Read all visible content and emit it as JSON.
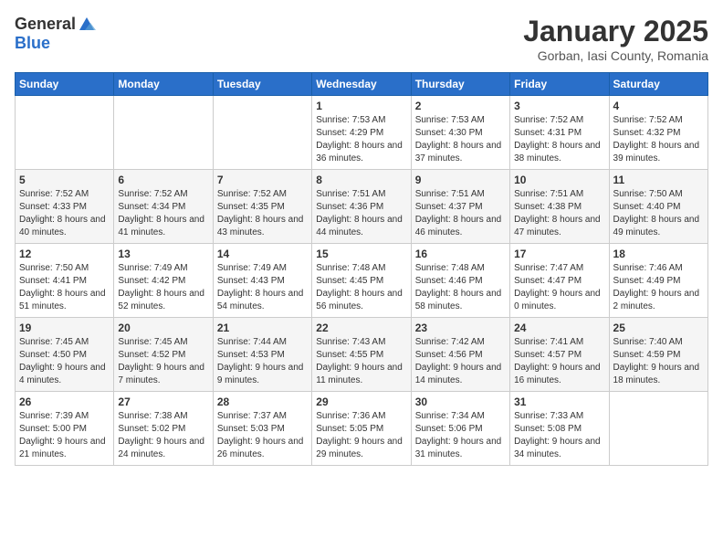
{
  "header": {
    "logo_general": "General",
    "logo_blue": "Blue",
    "month_title": "January 2025",
    "location": "Gorban, Iasi County, Romania"
  },
  "days_of_week": [
    "Sunday",
    "Monday",
    "Tuesday",
    "Wednesday",
    "Thursday",
    "Friday",
    "Saturday"
  ],
  "weeks": [
    [
      {
        "day": "",
        "info": ""
      },
      {
        "day": "",
        "info": ""
      },
      {
        "day": "",
        "info": ""
      },
      {
        "day": "1",
        "info": "Sunrise: 7:53 AM\nSunset: 4:29 PM\nDaylight: 8 hours and 36 minutes."
      },
      {
        "day": "2",
        "info": "Sunrise: 7:53 AM\nSunset: 4:30 PM\nDaylight: 8 hours and 37 minutes."
      },
      {
        "day": "3",
        "info": "Sunrise: 7:52 AM\nSunset: 4:31 PM\nDaylight: 8 hours and 38 minutes."
      },
      {
        "day": "4",
        "info": "Sunrise: 7:52 AM\nSunset: 4:32 PM\nDaylight: 8 hours and 39 minutes."
      }
    ],
    [
      {
        "day": "5",
        "info": "Sunrise: 7:52 AM\nSunset: 4:33 PM\nDaylight: 8 hours and 40 minutes."
      },
      {
        "day": "6",
        "info": "Sunrise: 7:52 AM\nSunset: 4:34 PM\nDaylight: 8 hours and 41 minutes."
      },
      {
        "day": "7",
        "info": "Sunrise: 7:52 AM\nSunset: 4:35 PM\nDaylight: 8 hours and 43 minutes."
      },
      {
        "day": "8",
        "info": "Sunrise: 7:51 AM\nSunset: 4:36 PM\nDaylight: 8 hours and 44 minutes."
      },
      {
        "day": "9",
        "info": "Sunrise: 7:51 AM\nSunset: 4:37 PM\nDaylight: 8 hours and 46 minutes."
      },
      {
        "day": "10",
        "info": "Sunrise: 7:51 AM\nSunset: 4:38 PM\nDaylight: 8 hours and 47 minutes."
      },
      {
        "day": "11",
        "info": "Sunrise: 7:50 AM\nSunset: 4:40 PM\nDaylight: 8 hours and 49 minutes."
      }
    ],
    [
      {
        "day": "12",
        "info": "Sunrise: 7:50 AM\nSunset: 4:41 PM\nDaylight: 8 hours and 51 minutes."
      },
      {
        "day": "13",
        "info": "Sunrise: 7:49 AM\nSunset: 4:42 PM\nDaylight: 8 hours and 52 minutes."
      },
      {
        "day": "14",
        "info": "Sunrise: 7:49 AM\nSunset: 4:43 PM\nDaylight: 8 hours and 54 minutes."
      },
      {
        "day": "15",
        "info": "Sunrise: 7:48 AM\nSunset: 4:45 PM\nDaylight: 8 hours and 56 minutes."
      },
      {
        "day": "16",
        "info": "Sunrise: 7:48 AM\nSunset: 4:46 PM\nDaylight: 8 hours and 58 minutes."
      },
      {
        "day": "17",
        "info": "Sunrise: 7:47 AM\nSunset: 4:47 PM\nDaylight: 9 hours and 0 minutes."
      },
      {
        "day": "18",
        "info": "Sunrise: 7:46 AM\nSunset: 4:49 PM\nDaylight: 9 hours and 2 minutes."
      }
    ],
    [
      {
        "day": "19",
        "info": "Sunrise: 7:45 AM\nSunset: 4:50 PM\nDaylight: 9 hours and 4 minutes."
      },
      {
        "day": "20",
        "info": "Sunrise: 7:45 AM\nSunset: 4:52 PM\nDaylight: 9 hours and 7 minutes."
      },
      {
        "day": "21",
        "info": "Sunrise: 7:44 AM\nSunset: 4:53 PM\nDaylight: 9 hours and 9 minutes."
      },
      {
        "day": "22",
        "info": "Sunrise: 7:43 AM\nSunset: 4:55 PM\nDaylight: 9 hours and 11 minutes."
      },
      {
        "day": "23",
        "info": "Sunrise: 7:42 AM\nSunset: 4:56 PM\nDaylight: 9 hours and 14 minutes."
      },
      {
        "day": "24",
        "info": "Sunrise: 7:41 AM\nSunset: 4:57 PM\nDaylight: 9 hours and 16 minutes."
      },
      {
        "day": "25",
        "info": "Sunrise: 7:40 AM\nSunset: 4:59 PM\nDaylight: 9 hours and 18 minutes."
      }
    ],
    [
      {
        "day": "26",
        "info": "Sunrise: 7:39 AM\nSunset: 5:00 PM\nDaylight: 9 hours and 21 minutes."
      },
      {
        "day": "27",
        "info": "Sunrise: 7:38 AM\nSunset: 5:02 PM\nDaylight: 9 hours and 24 minutes."
      },
      {
        "day": "28",
        "info": "Sunrise: 7:37 AM\nSunset: 5:03 PM\nDaylight: 9 hours and 26 minutes."
      },
      {
        "day": "29",
        "info": "Sunrise: 7:36 AM\nSunset: 5:05 PM\nDaylight: 9 hours and 29 minutes."
      },
      {
        "day": "30",
        "info": "Sunrise: 7:34 AM\nSunset: 5:06 PM\nDaylight: 9 hours and 31 minutes."
      },
      {
        "day": "31",
        "info": "Sunrise: 7:33 AM\nSunset: 5:08 PM\nDaylight: 9 hours and 34 minutes."
      },
      {
        "day": "",
        "info": ""
      }
    ]
  ]
}
